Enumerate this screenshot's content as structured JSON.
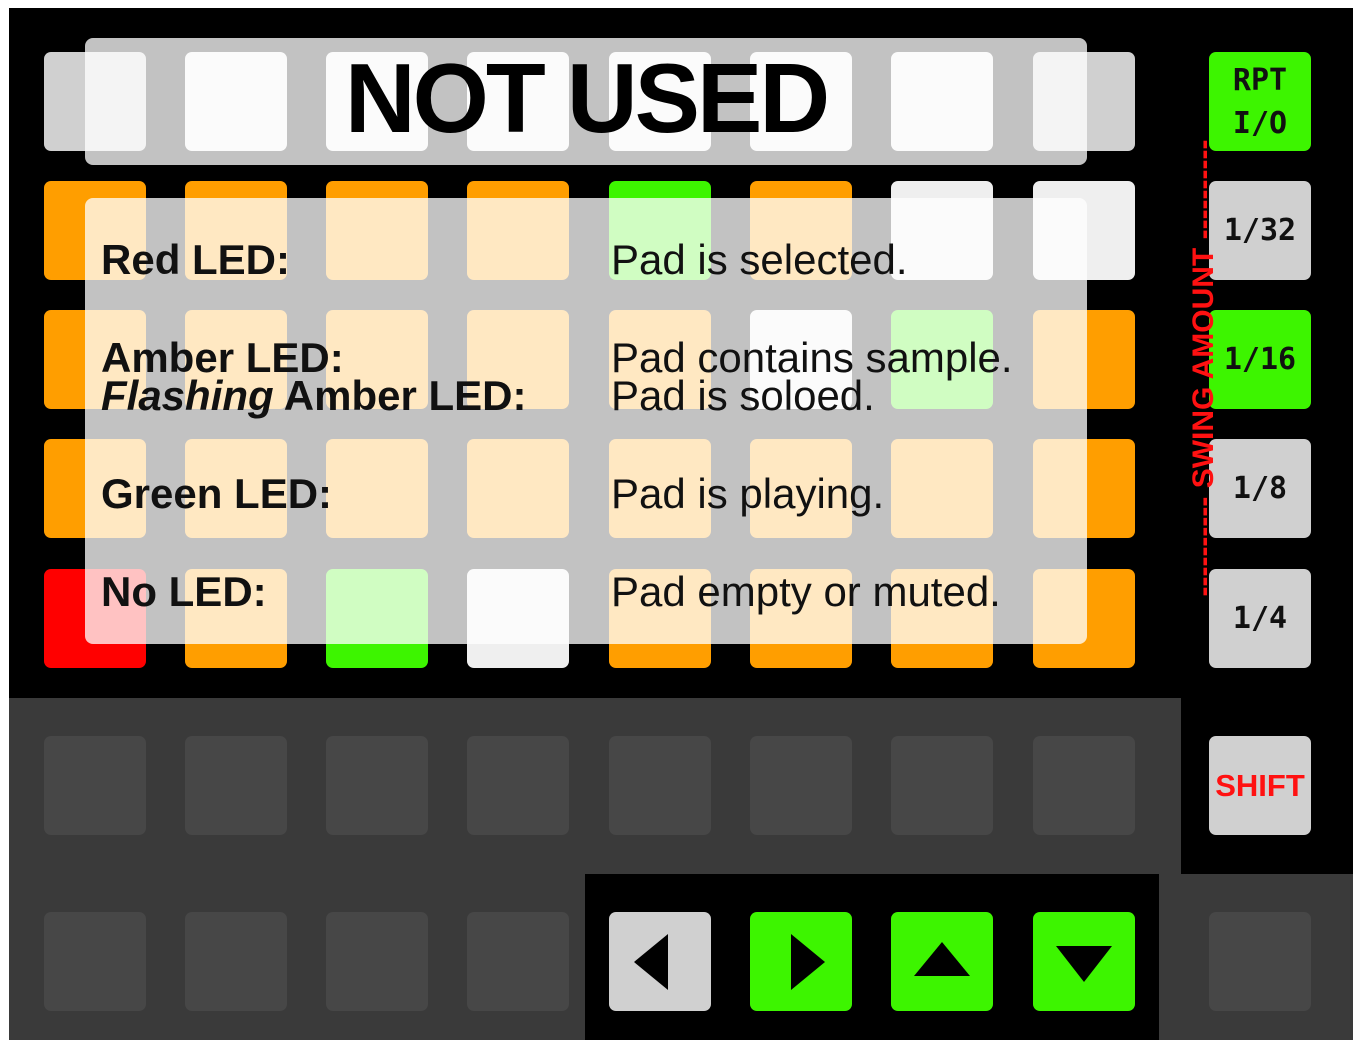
{
  "top_overlay": {
    "text": "NOT USED"
  },
  "legend": {
    "rows": [
      {
        "label": "Red LED:",
        "desc": "Pad is selected."
      },
      {
        "label": "Amber LED:",
        "desc": "Pad contains sample."
      },
      {
        "label_em": "Flashing",
        "label_rest": " Amber LED:",
        "desc": "Pad is soloed."
      },
      {
        "label": "Green LED:",
        "desc": "Pad is playing."
      },
      {
        "label": "No LED:",
        "desc": "Pad empty or muted."
      }
    ]
  },
  "side_buttons": {
    "rpt": "RPT\nI/O",
    "div32": "1/32",
    "div16": "1/16",
    "div8": "1/8",
    "div4": "1/4",
    "shift": "SHIFT"
  },
  "swing_label": "---------- SWING AMOUNT ----------",
  "colors": {
    "orange": "#ff9e00",
    "green": "#3df500",
    "red": "#ff0000",
    "gray": "#d0d0d0",
    "white": "#efefef",
    "dark": "#474747",
    "shift_text": "#ff1111"
  },
  "grid_rows": [
    [
      "gray",
      "white",
      "white",
      "white",
      "white",
      "white",
      "white",
      "gray"
    ],
    [
      "orange",
      "orange",
      "orange",
      "orange",
      "green",
      "orange",
      "white",
      "white"
    ],
    [
      "orange",
      "orange",
      "orange",
      "orange",
      "orange",
      "white",
      "green",
      "orange"
    ],
    [
      "orange",
      "orange",
      "orange",
      "orange",
      "orange",
      "orange",
      "orange",
      "orange"
    ],
    [
      "red",
      "orange",
      "green",
      "white",
      "orange",
      "orange",
      "orange",
      "orange"
    ]
  ],
  "nav_arrows": [
    {
      "name": "left",
      "color": "gray"
    },
    {
      "name": "right",
      "color": "green"
    },
    {
      "name": "up",
      "color": "green"
    },
    {
      "name": "down",
      "color": "green"
    }
  ]
}
